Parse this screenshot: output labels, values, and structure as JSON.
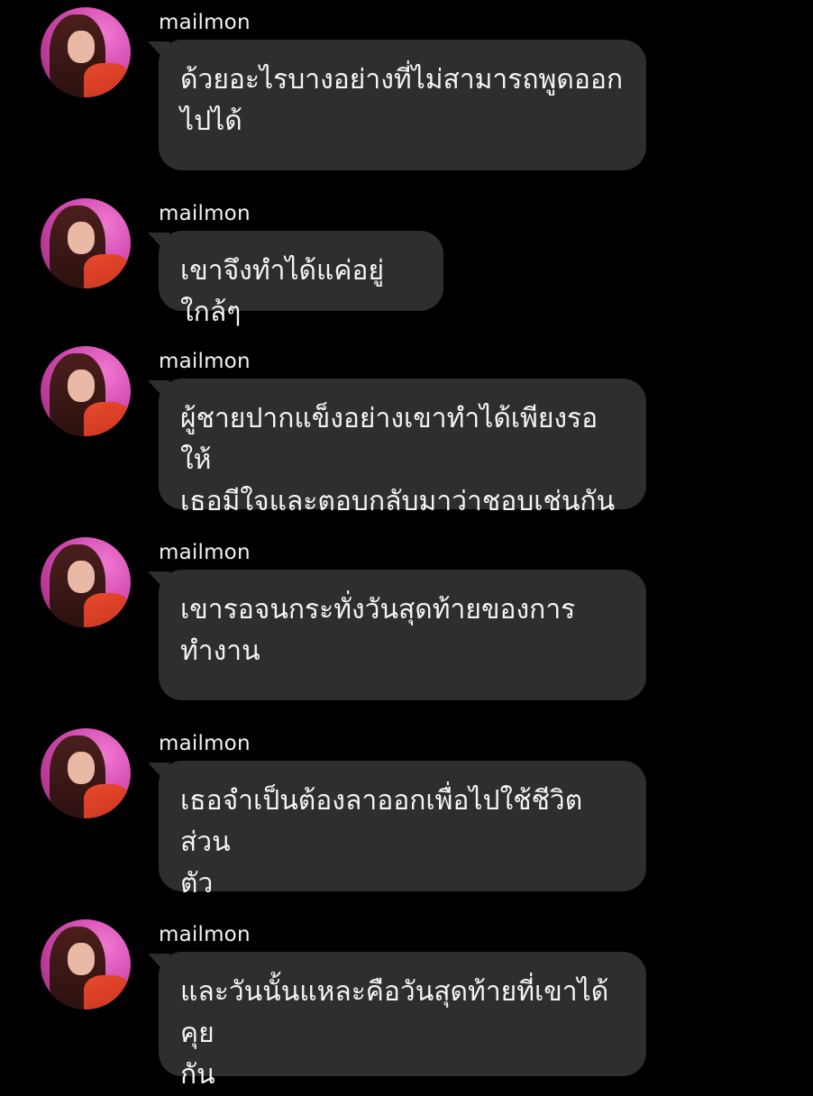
{
  "messages": [
    {
      "sender": "mailmon",
      "text": "ด้วยอะไรบางอย่างที่ไม่สามารถพูดออก\nไปได้"
    },
    {
      "sender": "mailmon",
      "text": "เขาจึงทำได้แค่อยู่ใกล้ๆ"
    },
    {
      "sender": "mailmon",
      "text": "ผู้ชายปากแข็งอย่างเขาทำได้เพียงรอให้\nเธอมีใจและตอบกลับมาว่าชอบเช่นกัน"
    },
    {
      "sender": "mailmon",
      "text": "เขารอจนกระทั่งวันสุดท้ายของการ\nทำงาน"
    },
    {
      "sender": "mailmon",
      "text": "เธอจำเป็นต้องลาออกเพื่อไปใช้ชีวิตส่วน\nตัว"
    },
    {
      "sender": "mailmon",
      "text": "และวันนั้นแหละคือวันสุดท้ายที่เขาได้คุย\nกัน"
    }
  ]
}
